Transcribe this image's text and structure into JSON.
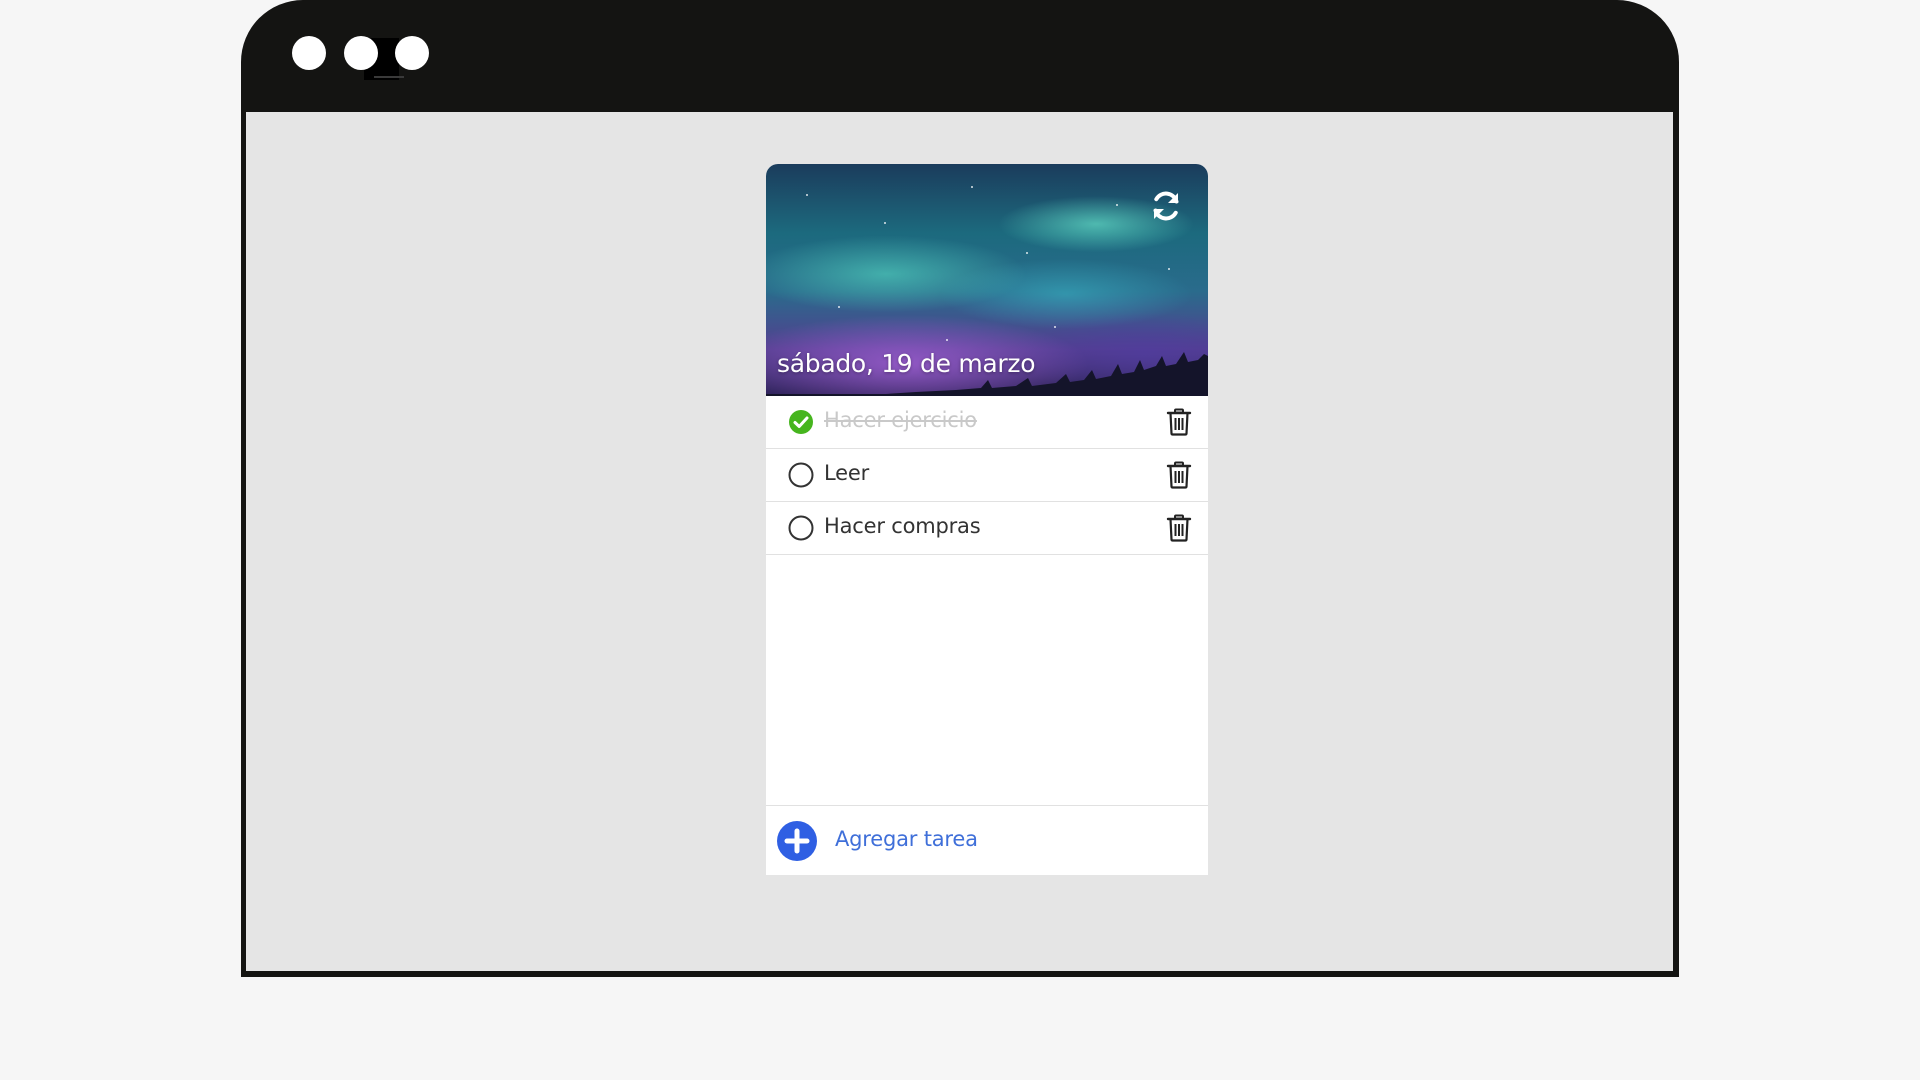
{
  "app": {
    "date_label": "sábado, 19 de marzo",
    "refresh_icon": "refresh-icon"
  },
  "tasks": [
    {
      "label": "Hacer ejercicio",
      "completed": true
    },
    {
      "label": "Leer",
      "completed": false
    },
    {
      "label": "Hacer compras",
      "completed": false
    }
  ],
  "footer": {
    "add_label": "Agregar tarea",
    "add_icon": "plus-circle-icon"
  },
  "colors": {
    "done_check": "#46b51e",
    "accent": "#3f6fd9",
    "window_frame": "#141412",
    "viewport_bg": "#e5e5e5"
  }
}
